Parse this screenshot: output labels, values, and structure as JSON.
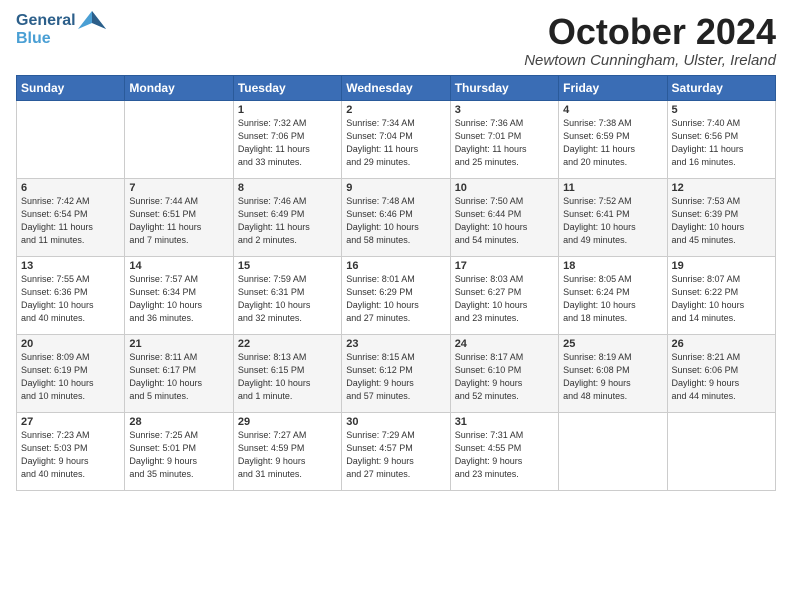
{
  "header": {
    "logo_line1": "General",
    "logo_line2": "Blue",
    "month_title": "October 2024",
    "subtitle": "Newtown Cunningham, Ulster, Ireland"
  },
  "days_of_week": [
    "Sunday",
    "Monday",
    "Tuesday",
    "Wednesday",
    "Thursday",
    "Friday",
    "Saturday"
  ],
  "weeks": [
    [
      {
        "day": "",
        "info": ""
      },
      {
        "day": "",
        "info": ""
      },
      {
        "day": "1",
        "info": "Sunrise: 7:32 AM\nSunset: 7:06 PM\nDaylight: 11 hours\nand 33 minutes."
      },
      {
        "day": "2",
        "info": "Sunrise: 7:34 AM\nSunset: 7:04 PM\nDaylight: 11 hours\nand 29 minutes."
      },
      {
        "day": "3",
        "info": "Sunrise: 7:36 AM\nSunset: 7:01 PM\nDaylight: 11 hours\nand 25 minutes."
      },
      {
        "day": "4",
        "info": "Sunrise: 7:38 AM\nSunset: 6:59 PM\nDaylight: 11 hours\nand 20 minutes."
      },
      {
        "day": "5",
        "info": "Sunrise: 7:40 AM\nSunset: 6:56 PM\nDaylight: 11 hours\nand 16 minutes."
      }
    ],
    [
      {
        "day": "6",
        "info": "Sunrise: 7:42 AM\nSunset: 6:54 PM\nDaylight: 11 hours\nand 11 minutes."
      },
      {
        "day": "7",
        "info": "Sunrise: 7:44 AM\nSunset: 6:51 PM\nDaylight: 11 hours\nand 7 minutes."
      },
      {
        "day": "8",
        "info": "Sunrise: 7:46 AM\nSunset: 6:49 PM\nDaylight: 11 hours\nand 2 minutes."
      },
      {
        "day": "9",
        "info": "Sunrise: 7:48 AM\nSunset: 6:46 PM\nDaylight: 10 hours\nand 58 minutes."
      },
      {
        "day": "10",
        "info": "Sunrise: 7:50 AM\nSunset: 6:44 PM\nDaylight: 10 hours\nand 54 minutes."
      },
      {
        "day": "11",
        "info": "Sunrise: 7:52 AM\nSunset: 6:41 PM\nDaylight: 10 hours\nand 49 minutes."
      },
      {
        "day": "12",
        "info": "Sunrise: 7:53 AM\nSunset: 6:39 PM\nDaylight: 10 hours\nand 45 minutes."
      }
    ],
    [
      {
        "day": "13",
        "info": "Sunrise: 7:55 AM\nSunset: 6:36 PM\nDaylight: 10 hours\nand 40 minutes."
      },
      {
        "day": "14",
        "info": "Sunrise: 7:57 AM\nSunset: 6:34 PM\nDaylight: 10 hours\nand 36 minutes."
      },
      {
        "day": "15",
        "info": "Sunrise: 7:59 AM\nSunset: 6:31 PM\nDaylight: 10 hours\nand 32 minutes."
      },
      {
        "day": "16",
        "info": "Sunrise: 8:01 AM\nSunset: 6:29 PM\nDaylight: 10 hours\nand 27 minutes."
      },
      {
        "day": "17",
        "info": "Sunrise: 8:03 AM\nSunset: 6:27 PM\nDaylight: 10 hours\nand 23 minutes."
      },
      {
        "day": "18",
        "info": "Sunrise: 8:05 AM\nSunset: 6:24 PM\nDaylight: 10 hours\nand 18 minutes."
      },
      {
        "day": "19",
        "info": "Sunrise: 8:07 AM\nSunset: 6:22 PM\nDaylight: 10 hours\nand 14 minutes."
      }
    ],
    [
      {
        "day": "20",
        "info": "Sunrise: 8:09 AM\nSunset: 6:19 PM\nDaylight: 10 hours\nand 10 minutes."
      },
      {
        "day": "21",
        "info": "Sunrise: 8:11 AM\nSunset: 6:17 PM\nDaylight: 10 hours\nand 5 minutes."
      },
      {
        "day": "22",
        "info": "Sunrise: 8:13 AM\nSunset: 6:15 PM\nDaylight: 10 hours\nand 1 minute."
      },
      {
        "day": "23",
        "info": "Sunrise: 8:15 AM\nSunset: 6:12 PM\nDaylight: 9 hours\nand 57 minutes."
      },
      {
        "day": "24",
        "info": "Sunrise: 8:17 AM\nSunset: 6:10 PM\nDaylight: 9 hours\nand 52 minutes."
      },
      {
        "day": "25",
        "info": "Sunrise: 8:19 AM\nSunset: 6:08 PM\nDaylight: 9 hours\nand 48 minutes."
      },
      {
        "day": "26",
        "info": "Sunrise: 8:21 AM\nSunset: 6:06 PM\nDaylight: 9 hours\nand 44 minutes."
      }
    ],
    [
      {
        "day": "27",
        "info": "Sunrise: 7:23 AM\nSunset: 5:03 PM\nDaylight: 9 hours\nand 40 minutes."
      },
      {
        "day": "28",
        "info": "Sunrise: 7:25 AM\nSunset: 5:01 PM\nDaylight: 9 hours\nand 35 minutes."
      },
      {
        "day": "29",
        "info": "Sunrise: 7:27 AM\nSunset: 4:59 PM\nDaylight: 9 hours\nand 31 minutes."
      },
      {
        "day": "30",
        "info": "Sunrise: 7:29 AM\nSunset: 4:57 PM\nDaylight: 9 hours\nand 27 minutes."
      },
      {
        "day": "31",
        "info": "Sunrise: 7:31 AM\nSunset: 4:55 PM\nDaylight: 9 hours\nand 23 minutes."
      },
      {
        "day": "",
        "info": ""
      },
      {
        "day": "",
        "info": ""
      }
    ]
  ]
}
